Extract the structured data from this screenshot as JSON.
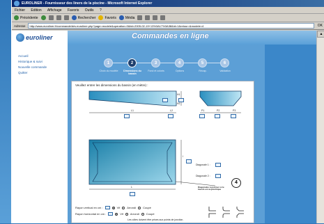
{
  "window": {
    "title": "EUROLINER - Fournisseur des liners de la piscine - Microsoft Internet Explorer"
  },
  "menu": [
    "Fichier",
    "Edition",
    "Affichage",
    "Favoris",
    "Outils",
    "?"
  ],
  "toolbar": {
    "back_label": "Précédente",
    "search_label": "Rechercher",
    "favorites_label": "Favoris",
    "media_label": "Média"
  },
  "address": {
    "label": "Adresse",
    "url": "http://www.euroliner.fr/commande/dev.euroliner.php?page=modele&operation=0&tid=2005-02-19+13%3A17%3A38&id=1&retour=&modele=4",
    "go_label": "OK"
  },
  "site": {
    "logo_text": "euroliner",
    "page_title": "Commandes en ligne",
    "nav": [
      "Accueil",
      "Historique & suivi",
      "Nouvelle commande",
      "Quitter"
    ]
  },
  "steps": [
    {
      "number": "1",
      "label": "Choix du modèle",
      "active": false
    },
    {
      "number": "2",
      "label": "Dimensions du bassin",
      "active": true
    },
    {
      "number": "3",
      "label": "Fond et coloris",
      "active": false
    },
    {
      "number": "4",
      "label": "Options",
      "active": false
    },
    {
      "number": "5",
      "label": "Récap.",
      "active": false
    },
    {
      "number": "6",
      "label": "Validation",
      "active": false
    }
  ],
  "form": {
    "instruction": "Veuillez entrer les dimensions du bassin (en mètre) :",
    "dim_labels": [
      "L1",
      "L2",
      "H1",
      "H2",
      "P1",
      "P2",
      "P3",
      "L",
      "l"
    ],
    "diagonale1_label": "Diagonale 1 :",
    "diagonale2_label": "Diagonale 2 :",
    "diagonale_note": "Diagonales à préciser si le bassin est asymétrique",
    "step_marker": "4",
    "rayon_vertical": {
      "label": "Rayon vertical en cm :",
      "options": [
        "Vif",
        "Arrondi",
        "Coupé"
      ],
      "selected": "Vif"
    },
    "rayon_horizontal": {
      "label": "Rayon horizontal en cm :",
      "options": [
        "Vif",
        "Arrondi",
        "Coupé"
      ],
      "selected": "Vif"
    },
    "footnote": "Les côtes doivent être prises aux points de jonction."
  },
  "colors": {
    "accent": "#1d3f6e",
    "page_bg": "#3b87c9",
    "panel": "#5c9fd6",
    "line": "#2f6aa8"
  }
}
